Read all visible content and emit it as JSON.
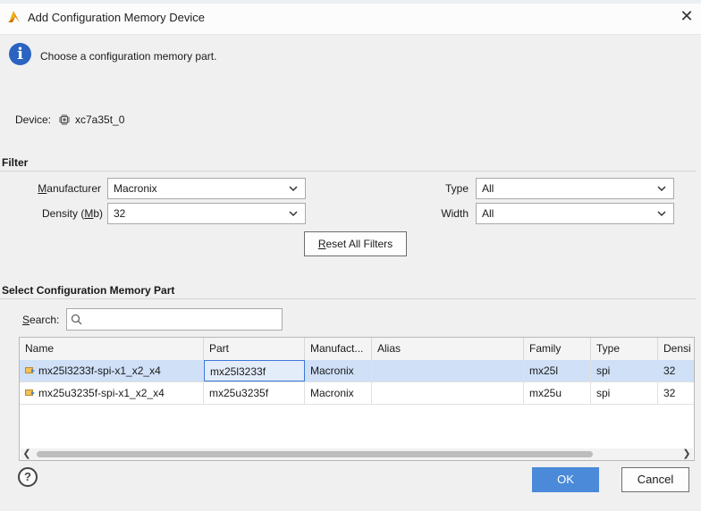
{
  "window": {
    "title": "Add Configuration Memory Device",
    "close_glyph": "✕"
  },
  "info": {
    "message": "Choose a configuration memory part."
  },
  "device": {
    "label": "Device:",
    "value": "xc7a35t_0"
  },
  "filter": {
    "section_title": "Filter",
    "manufacturer": {
      "label_u": "M",
      "label_rest": "anufacturer",
      "value": "Macronix"
    },
    "density": {
      "label_pre": "Density (",
      "label_u": "M",
      "label_post": "b)",
      "value": "32"
    },
    "type": {
      "label": "Type",
      "value": "All"
    },
    "width": {
      "label": "Width",
      "value": "All"
    },
    "reset": {
      "label_u": "R",
      "label_rest": "eset All Filters"
    }
  },
  "parts": {
    "section_title": "Select Configuration Memory Part",
    "search": {
      "label_u": "S",
      "label_rest": "earch:",
      "placeholder": ""
    },
    "columns": [
      "Name",
      "Part",
      "Manufact...",
      "Alias",
      "Family",
      "Type",
      "Densi"
    ],
    "rows": [
      {
        "name": "mx25l3233f-spi-x1_x2_x4",
        "part": "mx25l3233f",
        "manufacturer": "Macronix",
        "alias": "",
        "family": "mx25l",
        "type": "spi",
        "density": "32",
        "selected": true
      },
      {
        "name": "mx25u3235f-spi-x1_x2_x4",
        "part": "mx25u3235f",
        "manufacturer": "Macronix",
        "alias": "",
        "family": "mx25u",
        "type": "spi",
        "density": "32",
        "selected": false
      }
    ]
  },
  "footer": {
    "help": "?",
    "ok": "OK",
    "cancel": "Cancel"
  },
  "colors": {
    "accent": "#4a8ad8",
    "info_icon": "#2a63c2",
    "selected_row": "#cfe0f7"
  },
  "icons": {
    "logo": "vivado-logo-icon",
    "chip": "chip-icon",
    "search": "search-icon",
    "row": "memory-part-icon"
  }
}
